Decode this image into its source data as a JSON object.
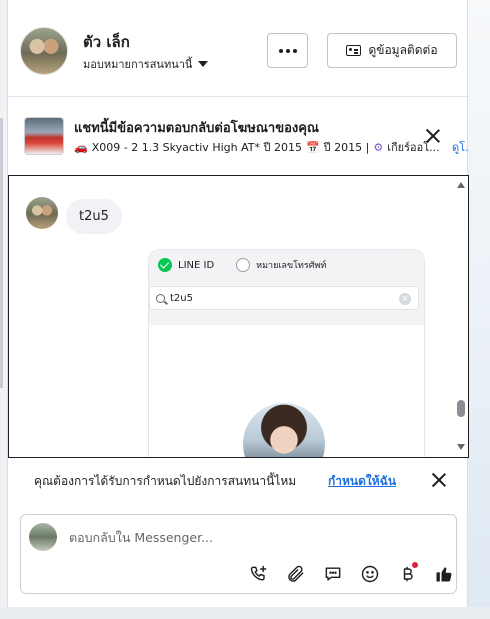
{
  "header": {
    "contact_name": "ตัว เล็ก",
    "assign_label": "มอบหมายการสนทนานี้",
    "more_label": "...",
    "contact_info_label": "ดูข้อมูลติดต่อ"
  },
  "ad": {
    "title": "แชทนี้มีข้อความตอบกลับต่อโฆษณาของคุณ",
    "vehicle_text": "X009 - 2 1.3 Skyactiv High AT* ปี 2015",
    "year_text": "ปี 2015 |",
    "gear_text": "เกียร์ออโ...",
    "link_text": "ดูโ..."
  },
  "chat": {
    "message_text": "t2u5",
    "shared_image": {
      "option_line_id": "LINE ID",
      "option_phone": "หมายเลขโทรศัพท์",
      "search_value": "t2u5"
    }
  },
  "reminder": {
    "text": "คุณต้องการได้รับการกำหนดไปยังการสนทนานี้ไหม",
    "link": "กำหนดให้ฉัน"
  },
  "composer": {
    "placeholder": "ตอบกลับใน Messenger..."
  },
  "colors": {
    "accent": "#216fdb",
    "line_green": "#06c755",
    "badge_red": "#e41e3f"
  }
}
